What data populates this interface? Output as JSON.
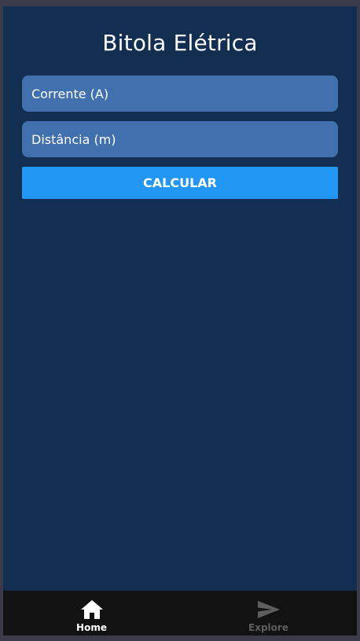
{
  "app": {
    "title": "Bitola Elétrica"
  },
  "form": {
    "corrente_placeholder": "Corrente (A)",
    "corrente_value": "",
    "distancia_placeholder": "Distância (m)",
    "distancia_value": "",
    "calculate_label": "CALCULAR"
  },
  "tabs": [
    {
      "label": "Home",
      "icon": "home-icon",
      "active": true
    },
    {
      "label": "Explore",
      "icon": "send-icon",
      "active": false
    }
  ],
  "colors": {
    "background": "#122e50",
    "input": "#4170ae",
    "button": "#2196f3",
    "tabbar": "#121212",
    "tab_active": "#ffffff",
    "tab_inactive": "#5e5e5e"
  }
}
